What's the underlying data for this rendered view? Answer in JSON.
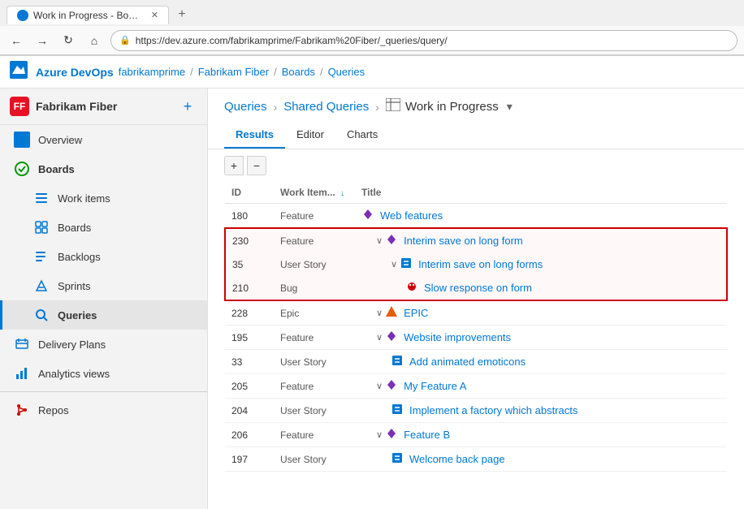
{
  "browser": {
    "tab_title": "Work in Progress - Boards",
    "url": "https://dev.azure.com/fabrikamprime/Fabrikam%20Fiber/_queries/query/",
    "new_tab_icon": "+",
    "back_icon": "←",
    "forward_icon": "→",
    "refresh_icon": "↻",
    "home_icon": "⌂",
    "lock_icon": "🔒"
  },
  "ado_header": {
    "brand": "Azure DevOps",
    "breadcrumbs": [
      "fabrikamprime",
      "Fabrikam Fiber",
      "Boards",
      "Queries"
    ]
  },
  "sidebar": {
    "project_name": "Fabrikam Fiber",
    "project_initial": "FF",
    "add_icon": "+",
    "items": [
      {
        "id": "overview",
        "label": "Overview",
        "icon": "📋",
        "active": false
      },
      {
        "id": "boards-group",
        "label": "Boards",
        "icon": "✅",
        "active": false,
        "bold": true
      },
      {
        "id": "work-items",
        "label": "Work items",
        "icon": "☰",
        "sub": true,
        "active": false
      },
      {
        "id": "boards-sub",
        "label": "Boards",
        "icon": "▦",
        "sub": true,
        "active": false
      },
      {
        "id": "backlogs",
        "label": "Backlogs",
        "icon": "☰",
        "sub": true,
        "active": false
      },
      {
        "id": "sprints",
        "label": "Sprints",
        "icon": "⚡",
        "sub": true,
        "active": false
      },
      {
        "id": "queries",
        "label": "Queries",
        "icon": "🔍",
        "sub": true,
        "active": true
      },
      {
        "id": "delivery-plans",
        "label": "Delivery Plans",
        "icon": "📅",
        "active": false
      },
      {
        "id": "analytics-views",
        "label": "Analytics views",
        "icon": "📊",
        "active": false
      },
      {
        "id": "repos",
        "label": "Repos",
        "icon": "🔧",
        "active": false
      }
    ]
  },
  "content": {
    "breadcrumb": {
      "queries": "Queries",
      "shared_queries": "Shared Queries",
      "work_in_progress": "Work in Progress"
    },
    "tabs": [
      {
        "id": "results",
        "label": "Results",
        "active": true
      },
      {
        "id": "editor",
        "label": "Editor",
        "active": false
      },
      {
        "id": "charts",
        "label": "Charts",
        "active": false
      }
    ],
    "table": {
      "columns": [
        {
          "id": "id",
          "label": "ID"
        },
        {
          "id": "type",
          "label": "Work Item..."
        },
        {
          "id": "title",
          "label": "Title"
        }
      ],
      "rows": [
        {
          "id": "180",
          "type": "Feature",
          "title": "Web features",
          "indent": 0,
          "expand": false,
          "icon": "feature",
          "highlighted": false
        },
        {
          "id": "230",
          "type": "Feature",
          "title": "Interim save on long form",
          "indent": 1,
          "expand": true,
          "icon": "feature",
          "highlighted": true
        },
        {
          "id": "35",
          "type": "User Story",
          "title": "Interim save on long forms",
          "indent": 2,
          "expand": true,
          "icon": "story",
          "highlighted": true
        },
        {
          "id": "210",
          "type": "Bug",
          "title": "Slow response on form",
          "indent": 3,
          "expand": false,
          "icon": "bug",
          "highlighted": true
        },
        {
          "id": "228",
          "type": "Epic",
          "title": "EPIC",
          "indent": 1,
          "expand": true,
          "icon": "epic",
          "highlighted": false
        },
        {
          "id": "195",
          "type": "Feature",
          "title": "Website improvements",
          "indent": 1,
          "expand": true,
          "icon": "feature",
          "highlighted": false
        },
        {
          "id": "33",
          "type": "User Story",
          "title": "Add animated emoticons",
          "indent": 2,
          "expand": false,
          "icon": "story",
          "highlighted": false
        },
        {
          "id": "205",
          "type": "Feature",
          "title": "My Feature A",
          "indent": 1,
          "expand": true,
          "icon": "feature",
          "highlighted": false
        },
        {
          "id": "204",
          "type": "User Story",
          "title": "Implement a factory which abstracts",
          "indent": 2,
          "expand": false,
          "icon": "story",
          "highlighted": false
        },
        {
          "id": "206",
          "type": "Feature",
          "title": "Feature B",
          "indent": 1,
          "expand": true,
          "icon": "feature",
          "highlighted": false
        },
        {
          "id": "197",
          "type": "User Story",
          "title": "Welcome back page",
          "indent": 2,
          "expand": false,
          "icon": "story",
          "highlighted": false
        }
      ]
    }
  }
}
